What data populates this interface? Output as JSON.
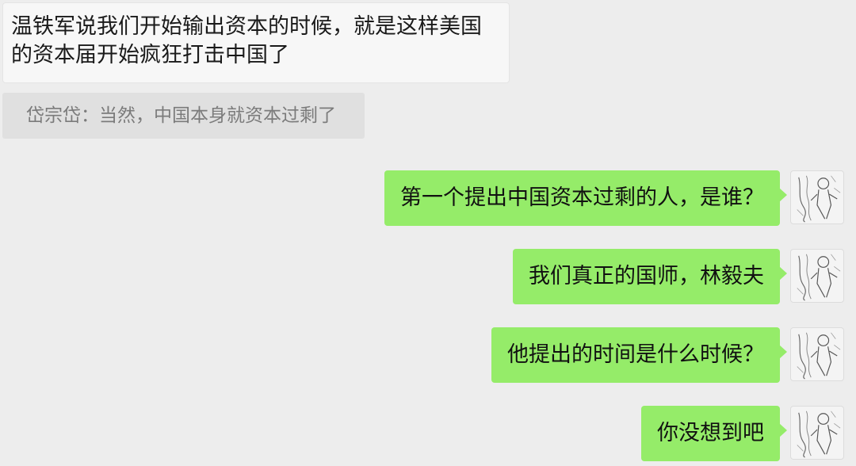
{
  "incoming_message": {
    "line1": "温铁军说我们开始输出资本的时候，就是这样美国",
    "line2": "的资本届开始疯狂打击中国了"
  },
  "quoted_reply": "岱宗岱：当然，中国本身就资本过剩了",
  "sent_messages": [
    {
      "text": "第一个提出中国资本过剩的人，是谁？"
    },
    {
      "text": "我们真正的国师，林毅夫"
    },
    {
      "text": "他提出的时间是什么时候？"
    },
    {
      "text": "你没想到吧"
    }
  ],
  "avatar_icon": "sketch-figure-avatar",
  "colors": {
    "background": "#ededed",
    "sent_bubble": "#95ec69",
    "incoming_bubble": "#f7f7f7",
    "quote_block": "#e0e0e0"
  }
}
